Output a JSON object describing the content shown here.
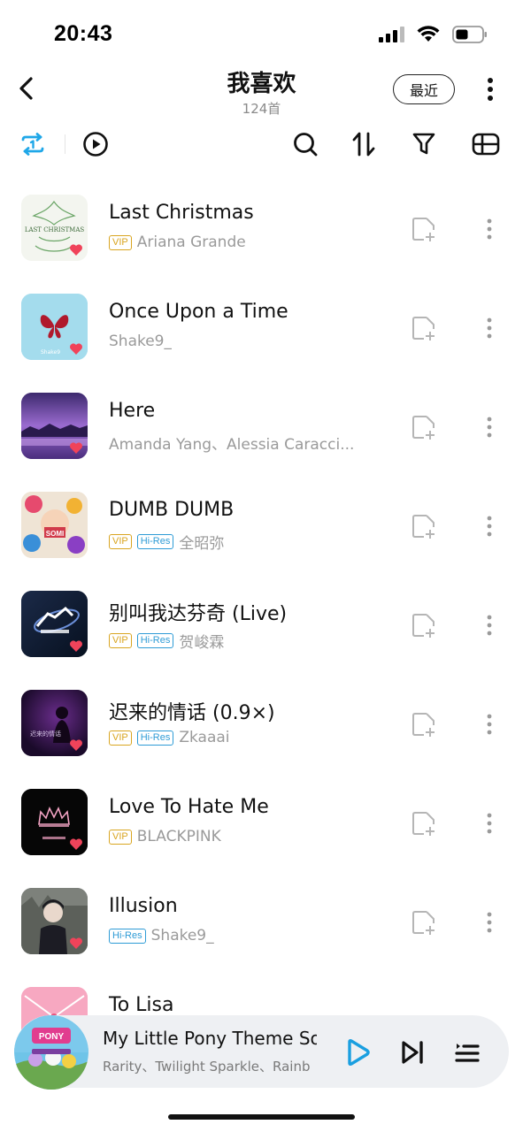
{
  "status_bar": {
    "time": "20:43"
  },
  "header": {
    "title": "我喜欢",
    "count": "124首",
    "recent_label": "最近"
  },
  "songs": [
    {
      "title": "Last Christmas",
      "badges": [
        "VIP"
      ],
      "artist": "Ariana Grande",
      "cover": "cover-last-christmas"
    },
    {
      "title": "Once Upon a Time",
      "badges": [],
      "artist": "Shake9_",
      "cover": "cover-once-upon-a-time"
    },
    {
      "title": "Here",
      "badges": [],
      "artist": "Amanda Yang、Alessia Caracci...",
      "cover": "cover-here"
    },
    {
      "title": "DUMB DUMB",
      "badges": [
        "VIP",
        "Hi-Res"
      ],
      "artist": "全昭弥",
      "cover": "cover-dumb-dumb"
    },
    {
      "title": "别叫我达芬奇 (Live)",
      "badges": [
        "VIP",
        "Hi-Res"
      ],
      "artist": "贺峻霖",
      "cover": "cover-bie-jiao"
    },
    {
      "title": "迟来的情话 (0.9×)",
      "badges": [
        "VIP",
        "Hi-Res"
      ],
      "artist": "Zkaaai",
      "cover": "cover-chi-lai"
    },
    {
      "title": "Love To Hate Me",
      "badges": [
        "VIP"
      ],
      "artist": "BLACKPINK",
      "cover": "cover-love-to-hate-me"
    },
    {
      "title": "Illusion",
      "badges": [
        "Hi-Res"
      ],
      "artist": "Shake9_",
      "cover": "cover-illusion"
    },
    {
      "title": "To Lisa",
      "badges": [],
      "artist": "",
      "cover": "cover-to-lisa"
    }
  ],
  "mini_player": {
    "title": "My Little Pony Theme So",
    "artist": "Rarity、Twilight Sparkle、Rainb",
    "cover": "cover-my-little-pony"
  },
  "colors": {
    "vip": "#d9a520",
    "hires": "#2e9bd6",
    "heart": "#f0435a",
    "active_tab": "#1fa7e8",
    "mini_player_bg": "#eef0f3"
  }
}
